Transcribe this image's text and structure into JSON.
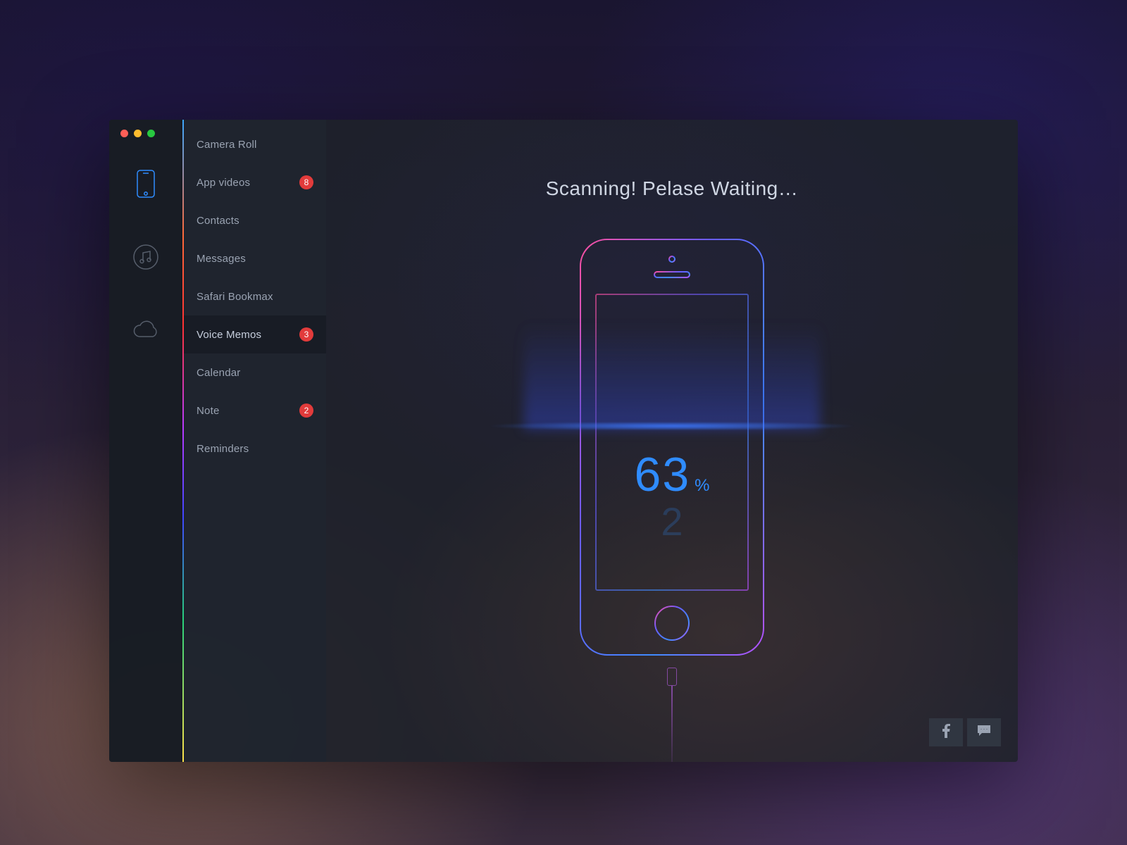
{
  "rail": {
    "items": [
      {
        "name": "phone",
        "active": true
      },
      {
        "name": "music",
        "active": false
      },
      {
        "name": "cloud",
        "active": false
      }
    ]
  },
  "categories": [
    {
      "label": "Camera Roll",
      "badge": null,
      "selected": false
    },
    {
      "label": "App videos",
      "badge": "8",
      "selected": false
    },
    {
      "label": "Contacts",
      "badge": null,
      "selected": false
    },
    {
      "label": "Messages",
      "badge": null,
      "selected": false
    },
    {
      "label": "Safari Bookmax",
      "badge": null,
      "selected": false
    },
    {
      "label": "Voice Memos",
      "badge": "3",
      "selected": true
    },
    {
      "label": "Calendar",
      "badge": null,
      "selected": false
    },
    {
      "label": "Note",
      "badge": "2",
      "selected": false
    },
    {
      "label": "Reminders",
      "badge": null,
      "selected": false
    }
  ],
  "scan": {
    "status_text": "Scanning! Pelase Waiting…",
    "percent_value": "63",
    "percent_symbol": "%",
    "percent_ghost": "2"
  },
  "footer": {
    "facebook_label": "f",
    "chat_label": "chat"
  },
  "colors": {
    "accent": "#2f8cff",
    "badge": "#e23b3b"
  }
}
